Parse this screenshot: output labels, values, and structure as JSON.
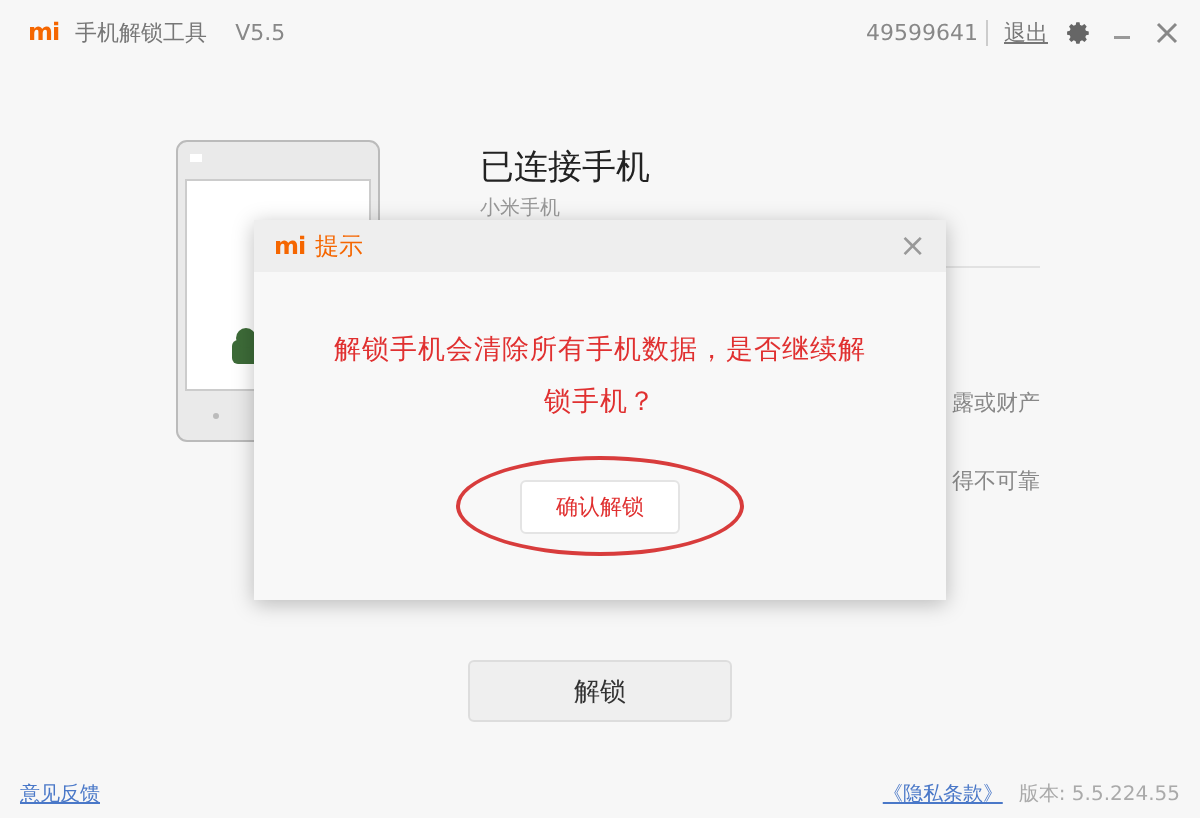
{
  "window": {
    "logo": "mi",
    "title": "手机解锁工具",
    "version": "V5.5",
    "account": "49599641",
    "logout": "退出"
  },
  "device": {
    "heading": "已连接手机",
    "model": "小米手机",
    "notes": [
      "露或财产",
      "得不可靠"
    ]
  },
  "unlock_button": "解锁",
  "dialog": {
    "logo": "mi",
    "title": "提示",
    "close": "×",
    "message": "解锁手机会清除所有手机数据，是否继续解锁手机？",
    "confirm": "确认解锁",
    "confirm_circled": true
  },
  "footer": {
    "feedback": "意见反馈",
    "privacy": "《隐私条款》",
    "version": "版本: 5.5.224.55"
  }
}
